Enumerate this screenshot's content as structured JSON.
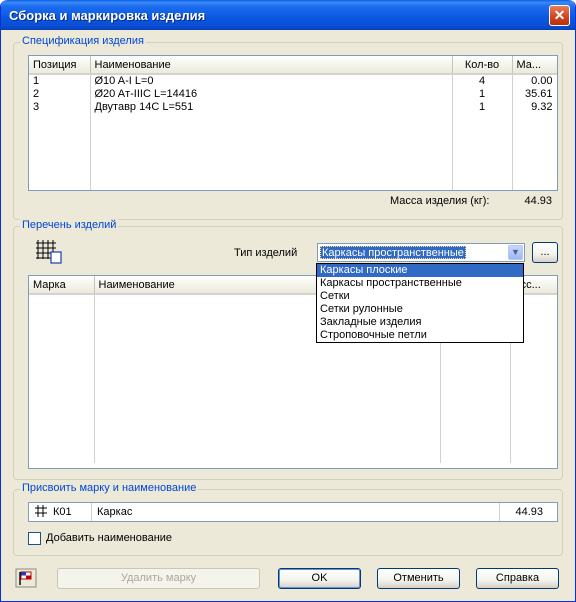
{
  "window": {
    "title": "Сборка и маркировка изделия",
    "close_glyph": "✕"
  },
  "spec": {
    "legend": "Спецификация изделия",
    "columns": [
      "Позиция",
      "Наименование",
      "Кол-во",
      "Ма..."
    ],
    "rows": [
      {
        "pos": "1",
        "name": "Ø10 A-I L=0",
        "qty": "4",
        "mass": "0.00"
      },
      {
        "pos": "2",
        "name": "Ø20 Aт-IIIC L=14416",
        "qty": "1",
        "mass": "35.61"
      },
      {
        "pos": "3",
        "name": "Двутавр 14С L=551",
        "qty": "1",
        "mass": "9.32"
      }
    ],
    "mass_label": "Масса изделия (кг):",
    "mass_value": "44.93"
  },
  "products": {
    "legend": "Перечень изделий",
    "type_label": "Тип изделий",
    "type_value": "Каркасы пространственные",
    "browse_label": "...",
    "columns": [
      "Марка",
      "Наименование",
      "",
      "асс..."
    ],
    "options": [
      "Каркасы плоские",
      "Каркасы пространственные",
      "Сетки",
      "Сетки рулонные",
      "Закладные изделия",
      "Строповочные петли"
    ],
    "selected_option": "Каркасы плоские"
  },
  "assign": {
    "legend": "Присвоить марку и наименование",
    "mark": "К01",
    "name": "Каркас",
    "mass": "44.93",
    "checkbox_label": "Добавить наименование",
    "checkbox_checked": false
  },
  "buttons": {
    "delete_mark": "Удалить марку",
    "ok": "OK",
    "cancel": "Отменить",
    "help": "Справка"
  },
  "icons": {
    "frame_grid": "frame-grid-icon",
    "flag": "flag-icon",
    "dropdown_arrow": "chevron-down-icon"
  }
}
